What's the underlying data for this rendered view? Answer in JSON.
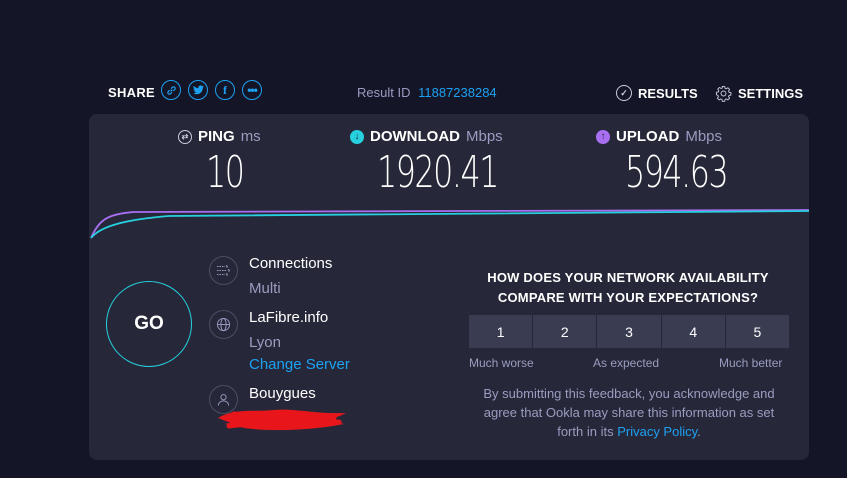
{
  "header": {
    "share_label": "SHARE",
    "share_icons": [
      "link-icon",
      "twitter-icon",
      "facebook-icon",
      "more-icon"
    ],
    "result_label": "Result ID",
    "result_id": "11887238284",
    "results_label": "RESULTS",
    "settings_label": "SETTINGS"
  },
  "metrics": {
    "ping": {
      "label": "PING",
      "unit": "ms",
      "value": "10"
    },
    "download": {
      "label": "DOWNLOAD",
      "unit": "Mbps",
      "value": "1920.41"
    },
    "upload": {
      "label": "UPLOAD",
      "unit": "Mbps",
      "value": "594.63"
    }
  },
  "go_label": "GO",
  "connections": {
    "title": "Connections",
    "value": "Multi"
  },
  "server": {
    "name": "LaFibre.info",
    "location": "Lyon",
    "change_label": "Change Server"
  },
  "provider": {
    "name": "Bouygues"
  },
  "survey": {
    "question": "HOW DOES YOUR NETWORK AVAILABILITY COMPARE WITH YOUR EXPECTATIONS?",
    "options": [
      "1",
      "2",
      "3",
      "4",
      "5"
    ],
    "label_low": "Much worse",
    "label_mid": "As expected",
    "label_high": "Much better",
    "disclaimer": "By submitting this feedback, you acknowledge and agree that Ookla may share this information as set forth in its",
    "privacy_link": "Privacy Policy",
    "period": "."
  },
  "colors": {
    "accent_cyan": "#26d0df",
    "accent_purple": "#a96ff2",
    "link_blue": "#1da1f2",
    "redaction_red": "#e8161b"
  }
}
